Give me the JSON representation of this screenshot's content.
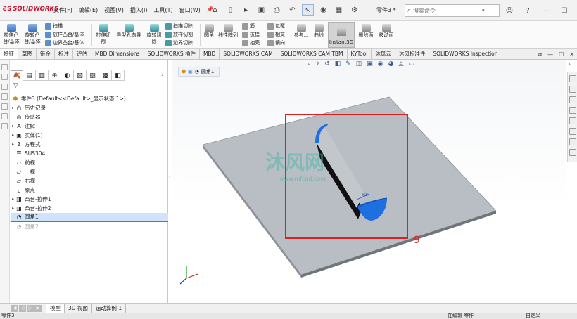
{
  "app": {
    "logo": "SOLIDWORKS",
    "menu": [
      "文件(F)",
      "编辑(E)",
      "视图(V)",
      "插入(I)",
      "工具(T)",
      "窗口(W)"
    ],
    "document_name": "零件3 *",
    "search_placeholder": "搜索命令"
  },
  "ribbon": {
    "big_buttons": {
      "extrude_boss": "拉伸凸台/基体",
      "revolve_boss": "旋转凸台/基体",
      "extrude_cut": "拉伸切除",
      "hole_wizard": "异型孔向导",
      "revolve_cut": "旋转切除",
      "fillet": "圆角",
      "linear_pattern": "线性阵列",
      "ref_geometry": "参考...",
      "curves": "曲线",
      "instant3d": "Instant3D",
      "delete_face": "删除面",
      "move_face": "移动面"
    },
    "small_buttons": {
      "sweep": "扫描",
      "loft": "放样凸台/基体",
      "boundary_boss": "边界凸台/基体",
      "swept_cut": "扫描切除",
      "lofted_cut": "放样切割",
      "boundary_cut": "边界切除",
      "rib": "筋",
      "draft": "拔模",
      "shell": "抽壳",
      "wrap": "包覆",
      "intersect": "相交",
      "mirror": "镜向"
    }
  },
  "tabs": [
    "特征",
    "草图",
    "钣金",
    "标注",
    "评估",
    "MBD Dimensions",
    "SOLIDWORKS 插件",
    "MBD",
    "SOLIDWORKS CAM",
    "SOLIDWORKS CAM TBM",
    "KYTool",
    "沐风云",
    "沐风标准件",
    "SOLIDWORKS Inspection"
  ],
  "active_tab": 0,
  "tree": {
    "root": "零件3  (Default<<Default>_显示状态 1>)",
    "items": [
      {
        "label": "历史记录",
        "arrow": true,
        "icon": "history-icon",
        "state": "normal"
      },
      {
        "label": "传感器",
        "arrow": false,
        "icon": "sensor-icon",
        "state": "normal"
      },
      {
        "label": "注解",
        "arrow": true,
        "icon": "annotation-icon",
        "state": "normal"
      },
      {
        "label": "实体(1)",
        "arrow": true,
        "icon": "solid-body-icon",
        "state": "normal"
      },
      {
        "label": "方程式",
        "arrow": true,
        "icon": "equation-icon",
        "state": "normal"
      },
      {
        "label": "SUS304",
        "arrow": false,
        "icon": "material-icon",
        "state": "normal"
      },
      {
        "label": "前视",
        "arrow": false,
        "icon": "plane-icon",
        "state": "normal"
      },
      {
        "label": "上视",
        "arrow": false,
        "icon": "plane-icon",
        "state": "normal"
      },
      {
        "label": "右视",
        "arrow": false,
        "icon": "plane-icon",
        "state": "normal"
      },
      {
        "label": "原点",
        "arrow": false,
        "icon": "origin-icon",
        "state": "normal"
      },
      {
        "label": "凸台-拉伸1",
        "arrow": true,
        "icon": "extrude-icon",
        "state": "normal"
      },
      {
        "label": "凸台-拉伸2",
        "arrow": true,
        "icon": "extrude-icon",
        "state": "normal"
      },
      {
        "label": "圆角1",
        "arrow": false,
        "icon": "fillet-icon",
        "state": "selected"
      },
      {
        "label": "圆角2",
        "arrow": false,
        "icon": "fillet-icon",
        "state": "suppressed"
      }
    ]
  },
  "graphics": {
    "breadcrumb_label": "圆角1",
    "annotation_number": "9",
    "dimension_label": "R8",
    "watermark_name": "沐风网",
    "watermark_url": "www.mfcad.com",
    "colors": {
      "highlight_box": "#e02020",
      "fillet_face": "#1e6fe0",
      "plate_top": "#b9bec4",
      "rib_side": "#111111",
      "watermark": "#3fb5a8"
    }
  },
  "bottom_tabs": [
    "模型",
    "3D 视图",
    "运动算例 1"
  ],
  "active_bottom_tab": 0,
  "status": {
    "left": "零件3",
    "middle": "在编辑 零件",
    "right": "自定义"
  }
}
